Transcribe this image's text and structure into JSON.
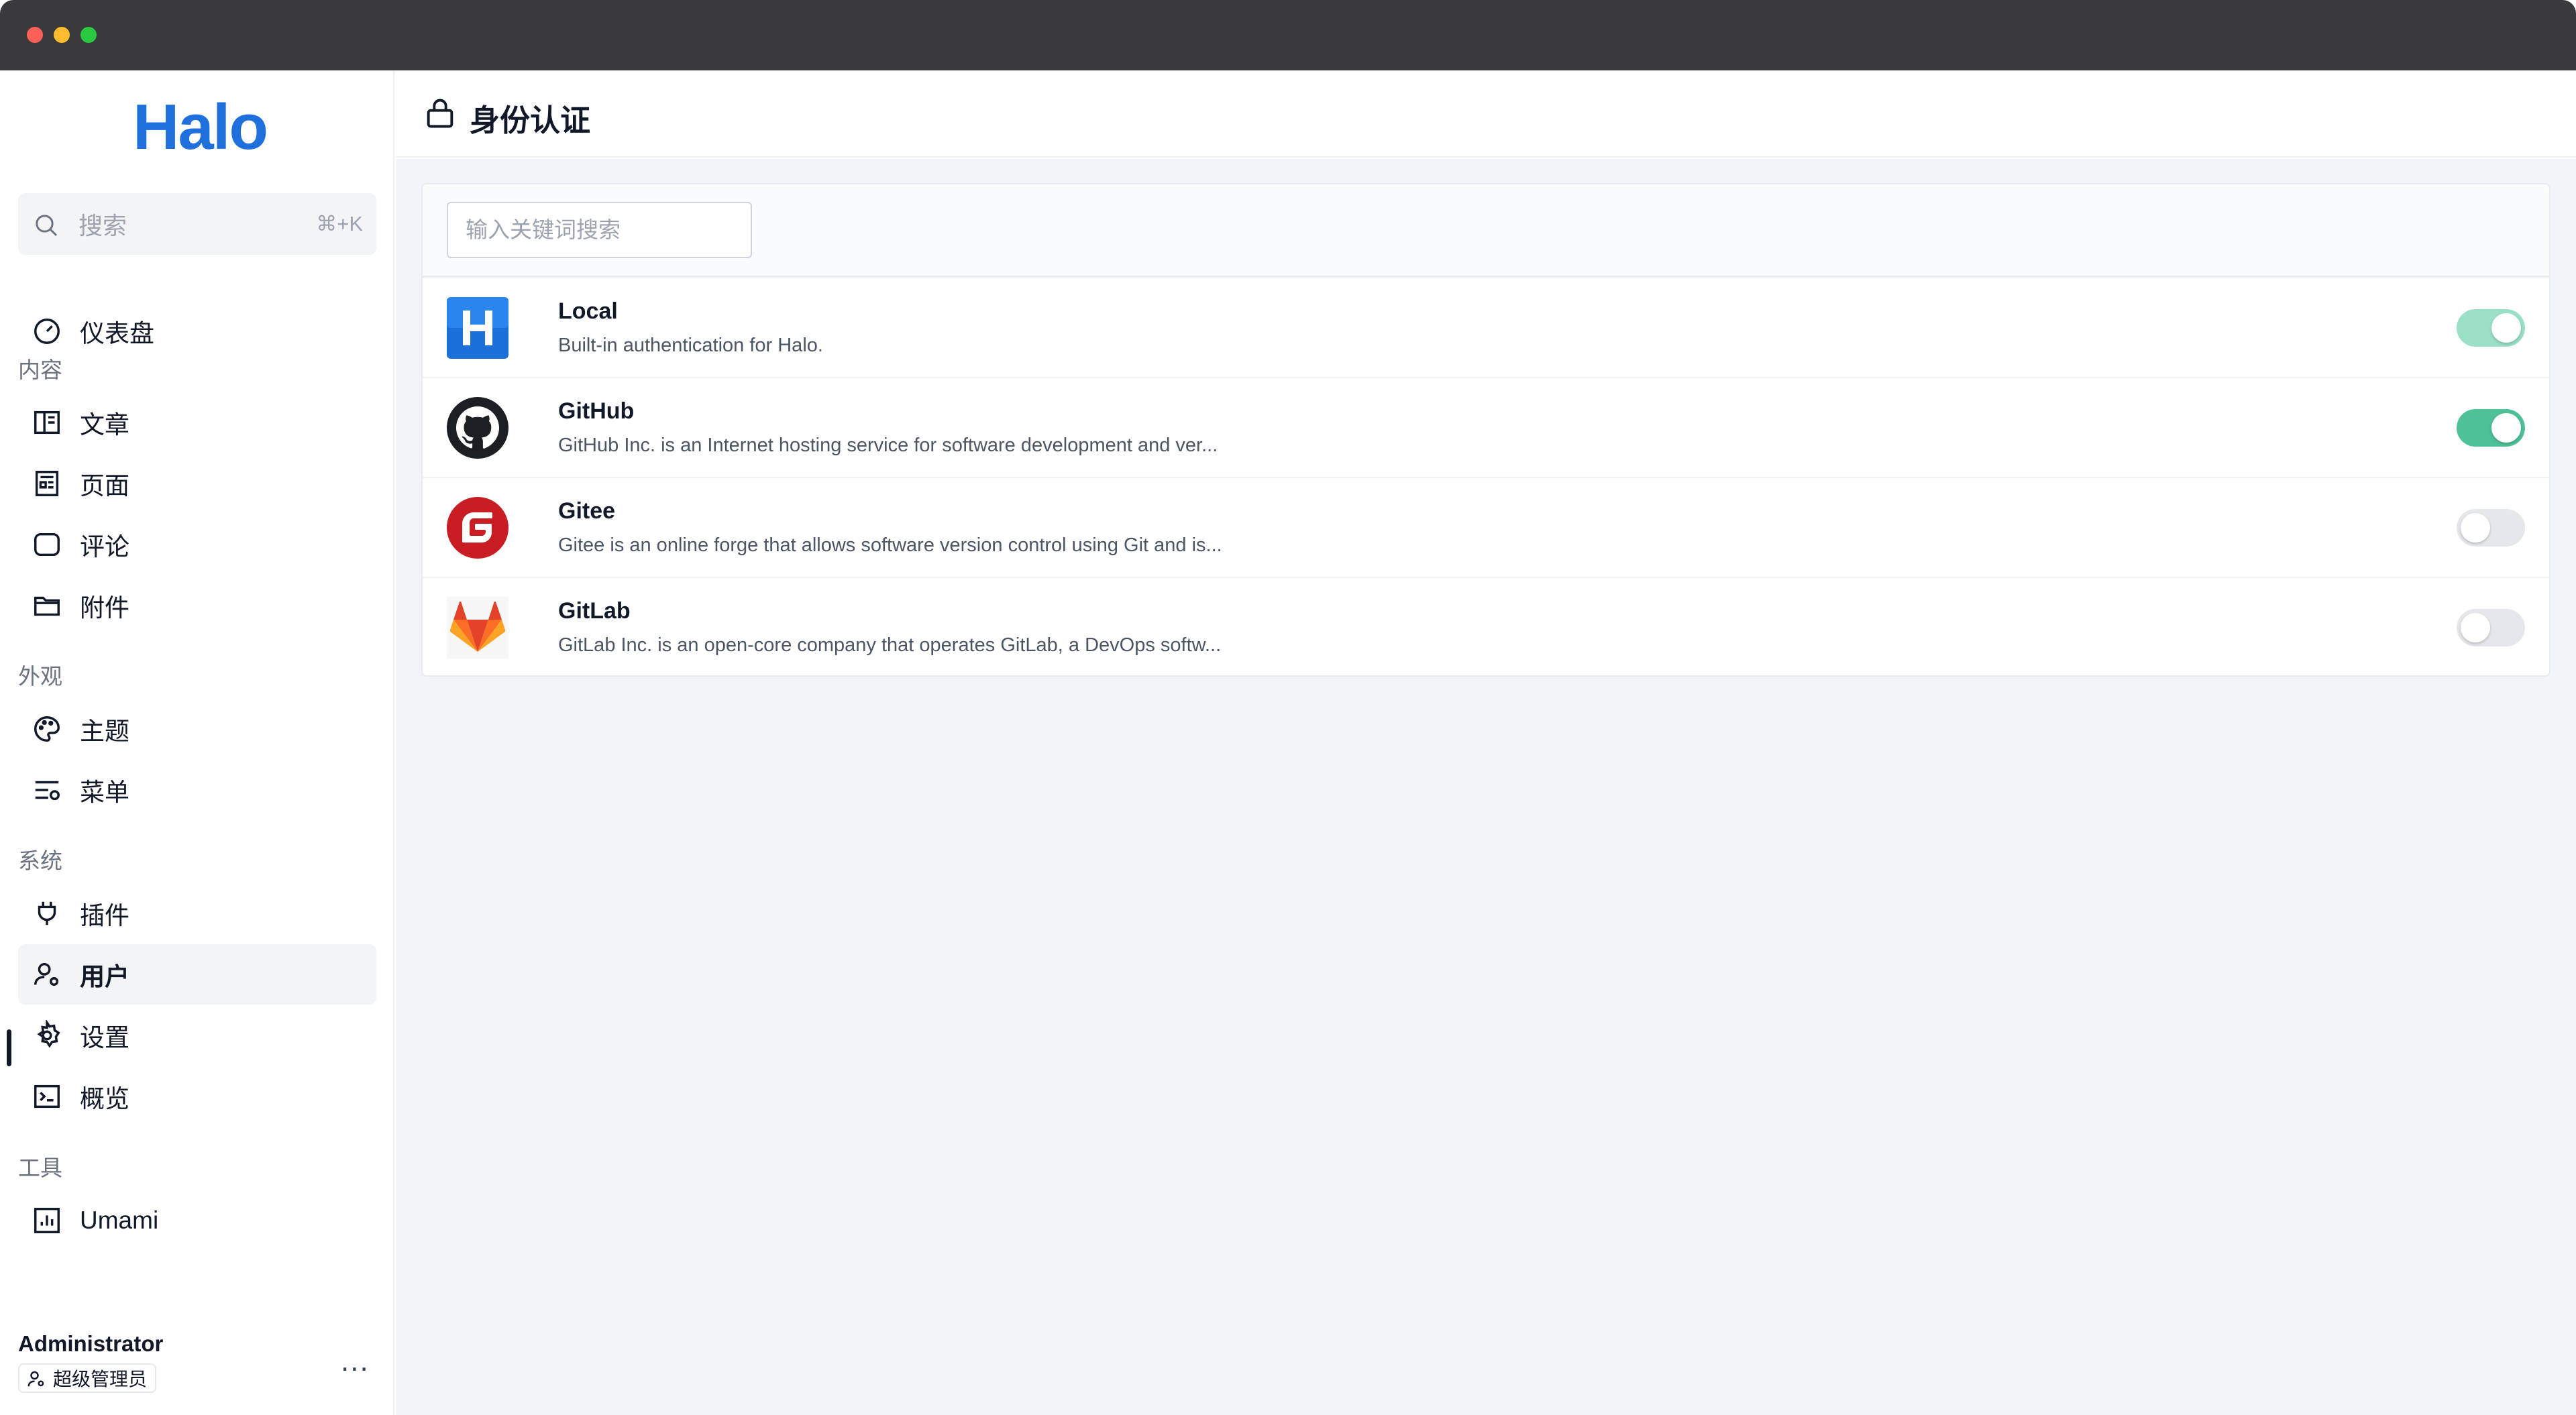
{
  "app": {
    "logo_text": "Halo"
  },
  "sidebar": {
    "search": {
      "placeholder": "搜索",
      "shortcut": "⌘+K"
    },
    "groups": [
      {
        "title": "",
        "items": [
          {
            "label": "仪表盘",
            "icon": "dashboard-icon"
          }
        ]
      },
      {
        "title": "内容",
        "items": [
          {
            "label": "文章",
            "icon": "book-icon"
          },
          {
            "label": "页面",
            "icon": "page-icon"
          },
          {
            "label": "评论",
            "icon": "comment-icon"
          },
          {
            "label": "附件",
            "icon": "folder-icon"
          }
        ]
      },
      {
        "title": "外观",
        "items": [
          {
            "label": "主题",
            "icon": "palette-icon"
          },
          {
            "label": "菜单",
            "icon": "menu-settings-icon"
          }
        ]
      },
      {
        "title": "系统",
        "items": [
          {
            "label": "插件",
            "icon": "plug-icon"
          },
          {
            "label": "用户",
            "icon": "user-settings-icon",
            "active": true
          },
          {
            "label": "设置",
            "icon": "gear-icon"
          },
          {
            "label": "概览",
            "icon": "terminal-icon"
          }
        ]
      },
      {
        "title": "工具",
        "items": [
          {
            "label": "Umami",
            "icon": "bar-chart-icon"
          }
        ]
      }
    ],
    "user": {
      "name": "Administrator",
      "role": "超级管理员",
      "more": "..."
    }
  },
  "header": {
    "title": "身份认证",
    "icon": "lock-icon"
  },
  "main": {
    "filter": {
      "placeholder": "输入关键词搜索",
      "value": ""
    },
    "providers": [
      {
        "name": "Local",
        "description": "Built-in authentication for Halo.",
        "enabled": true,
        "toggle_color": "#9ae0c6"
      },
      {
        "name": "GitHub",
        "description": "GitHub Inc. is an Internet hosting service for software development and ver...",
        "enabled": true,
        "toggle_color": "#4ec196"
      },
      {
        "name": "Gitee",
        "description": "Gitee is an online forge that allows software version control using Git and is...",
        "enabled": false,
        "toggle_color": "#e5e7eb"
      },
      {
        "name": "GitLab",
        "description": "GitLab Inc. is an open-core company that operates GitLab, a DevOps softw...",
        "enabled": false,
        "toggle_color": "#e5e7eb"
      }
    ]
  },
  "colors": {
    "brand": "#1f6fdc",
    "toggle_on": "#4ec196",
    "toggle_on_disabled": "#9ae0c6",
    "toggle_off": "#e5e7eb"
  }
}
